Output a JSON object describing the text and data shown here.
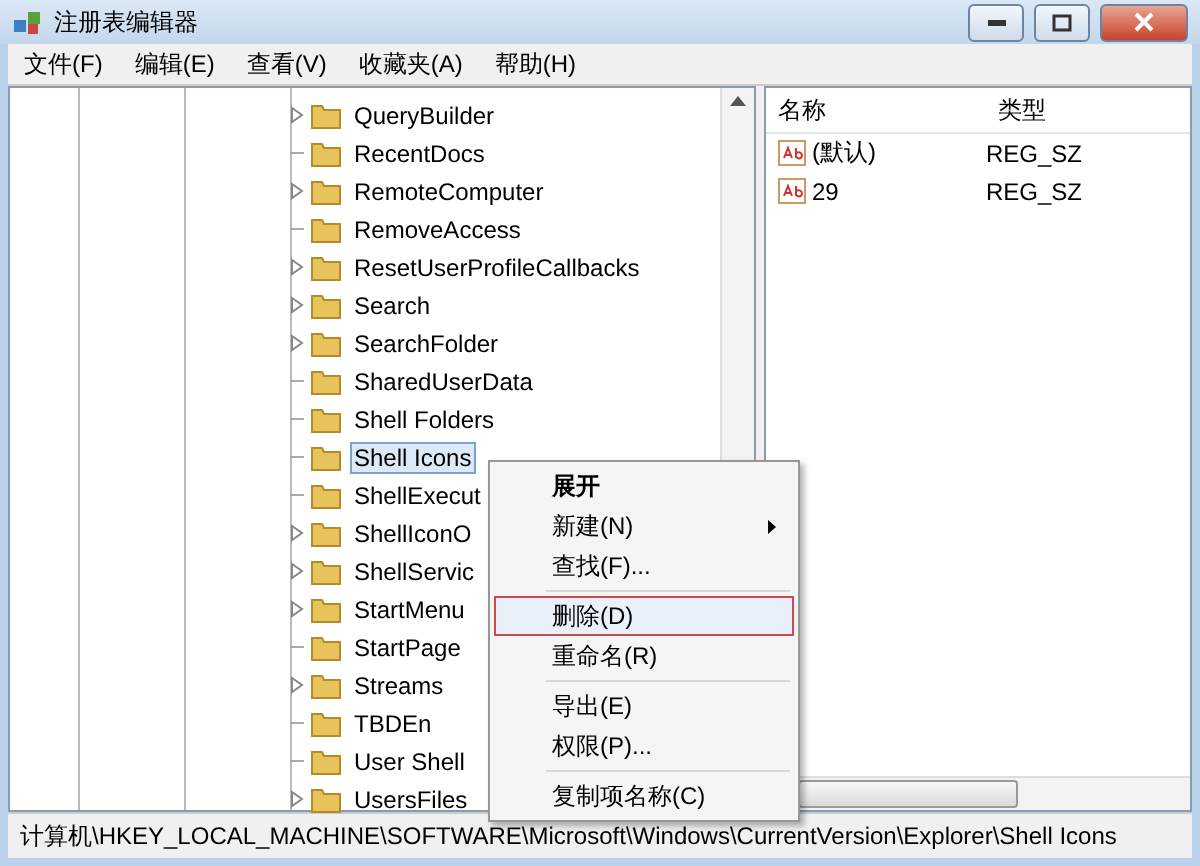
{
  "window": {
    "title": "注册表编辑器"
  },
  "menu_bar": [
    "文件(F)",
    "编辑(E)",
    "查看(V)",
    "收藏夹(A)",
    "帮助(H)"
  ],
  "tree": {
    "items": [
      {
        "label": "QueryBuilder",
        "expandable": true,
        "selected": false
      },
      {
        "label": "RecentDocs",
        "expandable": false,
        "selected": false
      },
      {
        "label": "RemoteComputer",
        "expandable": true,
        "selected": false
      },
      {
        "label": "RemoveAccess",
        "expandable": false,
        "selected": false
      },
      {
        "label": "ResetUserProfileCallbacks",
        "expandable": true,
        "selected": false
      },
      {
        "label": "Search",
        "expandable": true,
        "selected": false
      },
      {
        "label": "SearchFolder",
        "expandable": true,
        "selected": false
      },
      {
        "label": "SharedUserData",
        "expandable": false,
        "selected": false
      },
      {
        "label": "Shell Folders",
        "expandable": false,
        "selected": false
      },
      {
        "label": "Shell Icons",
        "expandable": false,
        "selected": true
      },
      {
        "label": "ShellExecut",
        "expandable": false,
        "selected": false
      },
      {
        "label": "ShellIconO",
        "expandable": true,
        "selected": false
      },
      {
        "label": "ShellServic",
        "expandable": true,
        "selected": false
      },
      {
        "label": "StartMenu",
        "expandable": true,
        "selected": false
      },
      {
        "label": "StartPage",
        "expandable": false,
        "selected": false
      },
      {
        "label": "Streams",
        "expandable": true,
        "selected": false
      },
      {
        "label": "TBDEn",
        "expandable": false,
        "selected": false
      },
      {
        "label": "User Shell",
        "expandable": false,
        "selected": false
      },
      {
        "label": "UsersFiles",
        "expandable": true,
        "selected": false
      }
    ]
  },
  "values": {
    "columns": [
      "名称",
      "类型"
    ],
    "rows": [
      {
        "name": "(默认)",
        "type": "REG_SZ"
      },
      {
        "name": "29",
        "type": "REG_SZ"
      }
    ]
  },
  "context_menu": [
    {
      "kind": "item",
      "label": "展开",
      "default": true,
      "submenu": false,
      "highlighted": false
    },
    {
      "kind": "item",
      "label": "新建(N)",
      "default": false,
      "submenu": true,
      "highlighted": false
    },
    {
      "kind": "item",
      "label": "查找(F)...",
      "default": false,
      "submenu": false,
      "highlighted": false
    },
    {
      "kind": "separator"
    },
    {
      "kind": "item",
      "label": "删除(D)",
      "default": false,
      "submenu": false,
      "highlighted": true
    },
    {
      "kind": "item",
      "label": "重命名(R)",
      "default": false,
      "submenu": false,
      "highlighted": false
    },
    {
      "kind": "separator"
    },
    {
      "kind": "item",
      "label": "导出(E)",
      "default": false,
      "submenu": false,
      "highlighted": false
    },
    {
      "kind": "item",
      "label": "权限(P)...",
      "default": false,
      "submenu": false,
      "highlighted": false
    },
    {
      "kind": "separator"
    },
    {
      "kind": "item",
      "label": "复制项名称(C)",
      "default": false,
      "submenu": false,
      "highlighted": false
    }
  ],
  "status_bar": "计算机\\HKEY_LOCAL_MACHINE\\SOFTWARE\\Microsoft\\Windows\\CurrentVersion\\Explorer\\Shell Icons"
}
